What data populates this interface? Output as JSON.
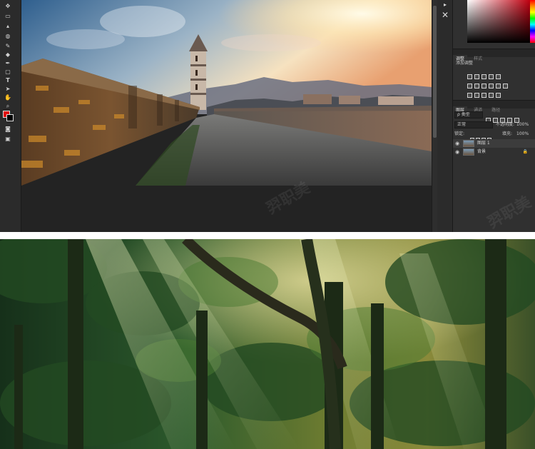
{
  "panels": {
    "adjustments": {
      "tabs": [
        "调整",
        "样式"
      ],
      "add_label": "添加调整"
    },
    "layers": {
      "tabs": [
        "图层",
        "通道",
        "路径"
      ],
      "filter_kind": "ρ 类型",
      "blend_mode": "正常",
      "opacity_label": "不透明度:",
      "opacity_value": "100%",
      "lock_label": "锁定:",
      "fill_label": "填充:",
      "fill_value": "100%",
      "items": [
        {
          "name": "图层 1",
          "selected": true
        },
        {
          "name": "背景",
          "selected": false
        }
      ]
    }
  },
  "watermark": "羿职美",
  "colors": {
    "foreground": "#e01010",
    "background": "#000000",
    "ui_bg": "#282828",
    "panel_bg": "#303030"
  },
  "icons": {
    "close": "close-icon",
    "foreground_color": "foreground-color-swatch",
    "visibility": "eye-icon",
    "lock": "lock-icon"
  }
}
